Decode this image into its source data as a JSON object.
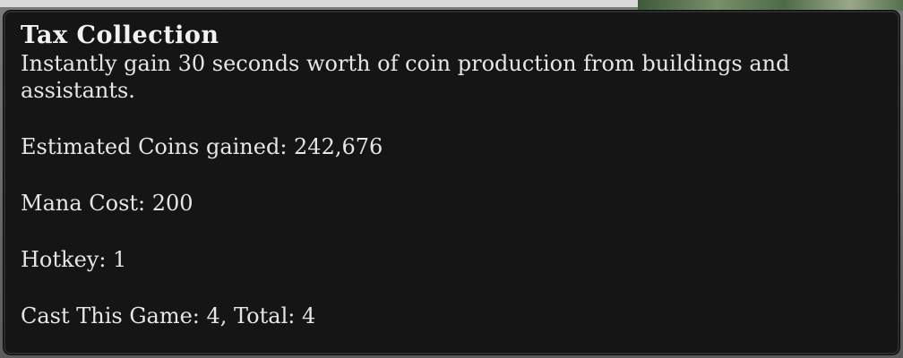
{
  "tooltip": {
    "title": "Tax Collection",
    "description": "Instantly gain 30 seconds worth of coin production from buildings and assistants.",
    "estimated_coins": "Estimated Coins gained: 242,676",
    "mana_cost": "Mana Cost: 200",
    "hotkey": "Hotkey: 1",
    "cast_count": "Cast This Game: 4, Total: 4"
  },
  "colors": {
    "tooltip_background": "#151515",
    "text": "#e6e6e6"
  }
}
